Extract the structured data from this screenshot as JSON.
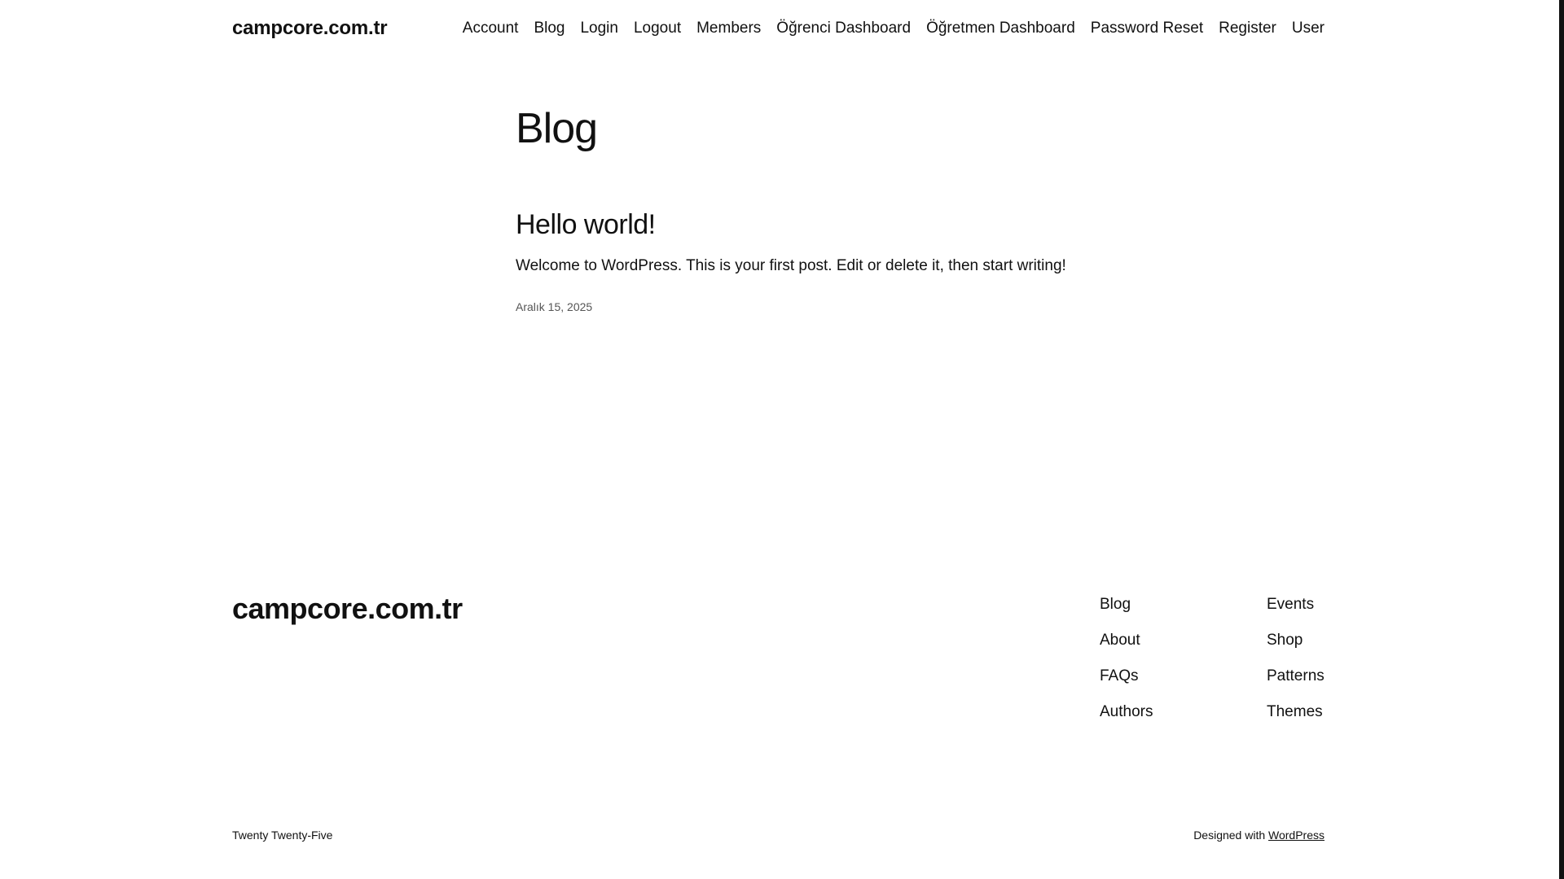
{
  "header": {
    "site_title": "campcore.com.tr",
    "nav": [
      {
        "label": "Account"
      },
      {
        "label": "Blog"
      },
      {
        "label": "Login"
      },
      {
        "label": "Logout"
      },
      {
        "label": "Members"
      },
      {
        "label": "Öğrenci Dashboard"
      },
      {
        "label": "Öğretmen Dashboard"
      },
      {
        "label": "Password Reset"
      },
      {
        "label": "Register"
      },
      {
        "label": "User"
      }
    ]
  },
  "main": {
    "page_title": "Blog",
    "posts": [
      {
        "title": "Hello world!",
        "excerpt": "Welcome to WordPress. This is your first post. Edit or delete it, then start writing!",
        "date": "Aralık 15, 2025"
      }
    ]
  },
  "footer": {
    "site_title": "campcore.com.tr",
    "col1": [
      {
        "label": "Blog"
      },
      {
        "label": "About"
      },
      {
        "label": "FAQs"
      },
      {
        "label": "Authors"
      }
    ],
    "col2": [
      {
        "label": "Events"
      },
      {
        "label": "Shop"
      },
      {
        "label": "Patterns"
      },
      {
        "label": "Themes"
      }
    ],
    "theme_name": "Twenty Twenty-Five",
    "credit_prefix": "Designed with ",
    "credit_link": "WordPress"
  },
  "colors": {
    "text": "#111111",
    "background": "#ffffff",
    "muted": "#555555"
  }
}
